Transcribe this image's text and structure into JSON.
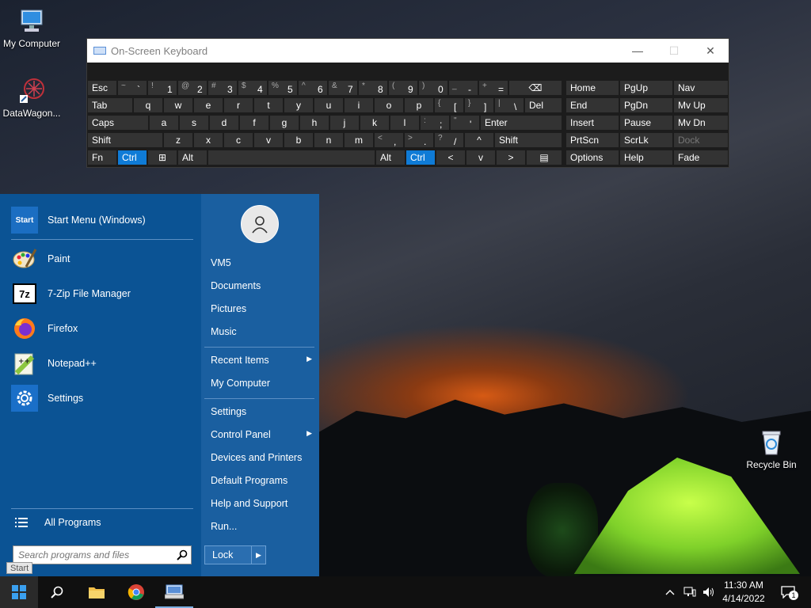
{
  "desktop": {
    "icons": [
      {
        "label": "My Computer"
      },
      {
        "label": "DataWagon..."
      },
      {
        "label": "Recycle Bin"
      }
    ]
  },
  "osk": {
    "title": "On-Screen Keyboard",
    "row1": [
      {
        "main": "Esc"
      },
      {
        "shift": "~",
        "main": "`"
      },
      {
        "shift": "!",
        "main": "1"
      },
      {
        "shift": "@",
        "main": "2"
      },
      {
        "shift": "#",
        "main": "3"
      },
      {
        "shift": "$",
        "main": "4"
      },
      {
        "shift": "%",
        "main": "5"
      },
      {
        "shift": "^",
        "main": "6"
      },
      {
        "shift": "&",
        "main": "7"
      },
      {
        "shift": "*",
        "main": "8"
      },
      {
        "shift": "(",
        "main": "9"
      },
      {
        "shift": ")",
        "main": "0"
      },
      {
        "shift": "_",
        "main": "-"
      },
      {
        "shift": "+",
        "main": "="
      },
      {
        "main": "⌫"
      }
    ],
    "row2": [
      {
        "main": "Tab"
      },
      {
        "main": "q"
      },
      {
        "main": "w"
      },
      {
        "main": "e"
      },
      {
        "main": "r"
      },
      {
        "main": "t"
      },
      {
        "main": "y"
      },
      {
        "main": "u"
      },
      {
        "main": "i"
      },
      {
        "main": "o"
      },
      {
        "main": "p"
      },
      {
        "shift": "{",
        "main": "["
      },
      {
        "shift": "}",
        "main": "]"
      },
      {
        "shift": "|",
        "main": "\\"
      },
      {
        "main": "Del"
      }
    ],
    "row3": [
      {
        "main": "Caps"
      },
      {
        "main": "a"
      },
      {
        "main": "s"
      },
      {
        "main": "d"
      },
      {
        "main": "f"
      },
      {
        "main": "g"
      },
      {
        "main": "h"
      },
      {
        "main": "j"
      },
      {
        "main": "k"
      },
      {
        "main": "l"
      },
      {
        "shift": ":",
        "main": ";"
      },
      {
        "shift": "\"",
        "main": "'"
      },
      {
        "main": "Enter"
      }
    ],
    "row4": [
      {
        "main": "Shift"
      },
      {
        "main": "z"
      },
      {
        "main": "x"
      },
      {
        "main": "c"
      },
      {
        "main": "v"
      },
      {
        "main": "b"
      },
      {
        "main": "n"
      },
      {
        "main": "m"
      },
      {
        "shift": "<",
        "main": ","
      },
      {
        "shift": ">",
        "main": "."
      },
      {
        "shift": "?",
        "main": "/"
      },
      {
        "main": "^"
      },
      {
        "main": "Shift"
      }
    ],
    "row5": [
      {
        "main": "Fn"
      },
      {
        "main": "Ctrl"
      },
      {
        "main": "⊞"
      },
      {
        "main": "Alt"
      },
      {
        "main": ""
      },
      {
        "main": "Alt"
      },
      {
        "main": "Ctrl"
      },
      {
        "main": "<"
      },
      {
        "main": "v"
      },
      {
        "main": ">"
      },
      {
        "main": "▤"
      }
    ],
    "nav": [
      [
        "Home",
        "PgUp",
        "Nav"
      ],
      [
        "End",
        "PgDn",
        "Mv Up"
      ],
      [
        "Insert",
        "Pause",
        "Mv Dn"
      ],
      [
        "PrtScn",
        "ScrLk",
        "Dock"
      ],
      [
        "Options",
        "Help",
        "Fade"
      ]
    ]
  },
  "start_menu": {
    "apps": [
      {
        "label": "Start Menu (Windows)",
        "icon": "start-menu-icon"
      },
      {
        "label": "Paint",
        "icon": "paint-icon"
      },
      {
        "label": "7-Zip File Manager",
        "icon": "7zip-icon"
      },
      {
        "label": "Firefox",
        "icon": "firefox-icon"
      },
      {
        "label": "Notepad++",
        "icon": "notepadpp-icon"
      },
      {
        "label": "Settings",
        "icon": "settings-gear-icon"
      }
    ],
    "start_icon_text": "Start",
    "sevenzip_icon_text": "7z",
    "all_programs": "All Programs",
    "search_placeholder": "Search programs and files",
    "right_links": [
      {
        "label": "VM5"
      },
      {
        "label": "Documents"
      },
      {
        "label": "Pictures"
      },
      {
        "label": "Music"
      },
      {
        "label": "Recent Items",
        "arrow": "▶"
      },
      {
        "label": "My Computer"
      },
      {
        "label": "Settings"
      },
      {
        "label": "Control Panel",
        "arrow": "▶"
      },
      {
        "label": "Devices and Printers"
      },
      {
        "label": "Default Programs"
      },
      {
        "label": "Help and Support"
      },
      {
        "label": "Run..."
      }
    ],
    "lock_label": "Lock",
    "lock_arrow": "▶",
    "start_tooltip": "Start"
  },
  "taskbar": {
    "time": "11:30 AM",
    "date": "4/14/2022",
    "notification_count": "1"
  }
}
